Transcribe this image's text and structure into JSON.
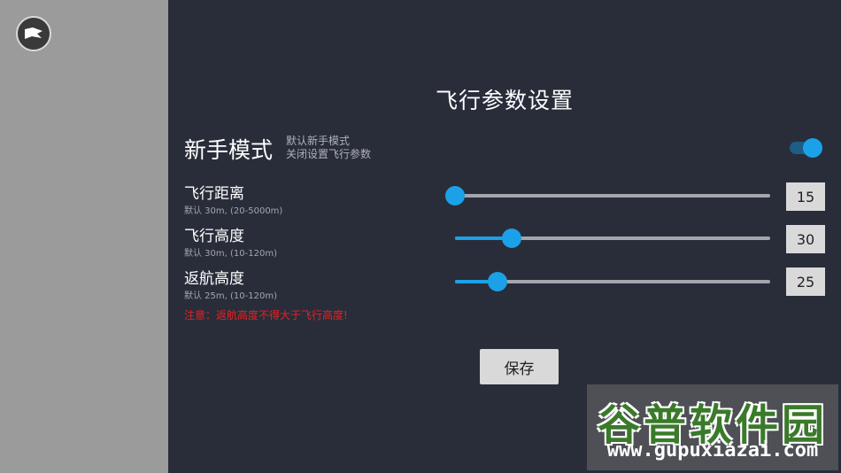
{
  "header": {
    "title": "飞行参数设置"
  },
  "back_button": {
    "icon": "flag-back-icon"
  },
  "beginner_mode": {
    "label": "新手模式",
    "desc_line1": "默认新手模式",
    "desc_line2": "关闭设置飞行参数",
    "enabled": true
  },
  "params": [
    {
      "label": "飞行距离",
      "hint": "默认 30m, (20-5000m)",
      "value": "15",
      "level_fraction": 0.0
    },
    {
      "label": "飞行高度",
      "hint": "默认 30m, (10-120m)",
      "value": "30",
      "level_fraction": 0.18
    },
    {
      "label": "返航高度",
      "hint": "默认 25m, (10-120m)",
      "value": "25",
      "level_fraction": 0.135
    }
  ],
  "warning": "注意：返航高度不得大于飞行高度!",
  "save_label": "保存",
  "watermark": {
    "brand": "谷普软件园",
    "url": "www.gupuxiazai.com"
  },
  "colors": {
    "panel_bg": "#292d3a",
    "sidebar_bg": "#9b9b9b",
    "accent": "#1ba1e8",
    "warning": "#e02424"
  }
}
